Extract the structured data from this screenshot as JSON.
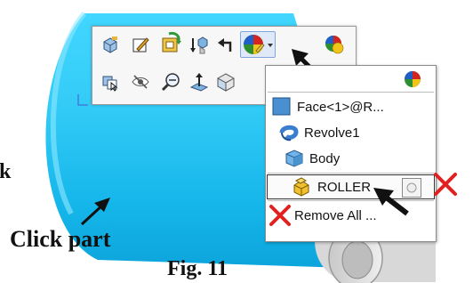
{
  "annotations": {
    "click_part": "Click part",
    "left_fragment": "k",
    "figure_label": "Fig. 11"
  },
  "menu": {
    "items": [
      {
        "label": "Face<1>@R...",
        "icon": "face-icon"
      },
      {
        "label": "Revolve1",
        "icon": "revolve-feature-icon"
      },
      {
        "label": "Body",
        "icon": "body-cube-icon"
      },
      {
        "label": "ROLLER",
        "icon": "part-icon",
        "selected": true
      },
      {
        "label": "Remove All ...",
        "icon": "red-x-icon"
      }
    ]
  },
  "toolbar": {
    "row1": [
      "edit-part-icon",
      "sketch-icon",
      "configuration-icon",
      "smart-mate-icon",
      "return-arrow-icon",
      "appearance-icon"
    ],
    "row2": [
      "select-other-icon",
      "hide-icon",
      "zoom-to-selection-icon",
      "normal-to-icon",
      "view-orientation-icon"
    ]
  },
  "colors": {
    "part_cyan": "#1ec0ee",
    "part_highlight": "#7ee3ff",
    "menu_border": "#8c8c8c",
    "remove_red": "#e12020"
  }
}
